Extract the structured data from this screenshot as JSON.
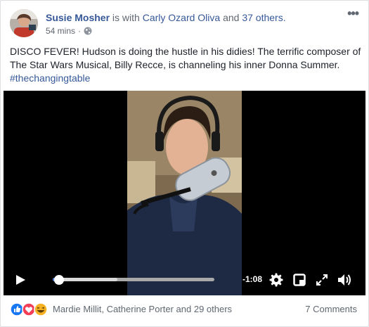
{
  "post": {
    "author": "Susie Mosher",
    "with_text": "is with",
    "tagged_person": "Carly Ozard Oliva",
    "and_text": "and",
    "tagged_others": "37 others.",
    "time": "54 mins",
    "audience_icon": "globe-icon",
    "text": "DISCO FEVER! Hudson is doing the hustle in his didies! The terrific composer of The Star Wars Musical, Billy Recce, is channeling his inner Donna Summer.",
    "hashtag": "#thechangingtable"
  },
  "video": {
    "time_remaining": "-1:08",
    "progress": 0.04,
    "buffered": 0.4,
    "controls": [
      "play-icon",
      "gear-icon",
      "pip-icon",
      "fullscreen-icon",
      "volume-icon"
    ]
  },
  "reactions": {
    "icons": [
      "like-icon",
      "love-icon",
      "haha-icon"
    ],
    "names": "Mardie Millit, Catherine Porter and 29 others",
    "comments": "7 Comments"
  },
  "colors": {
    "link": "#365899",
    "seek_played": "#4a76d6",
    "like": "#1877f2",
    "love": "#f33e58",
    "haha": "#f7b125"
  }
}
